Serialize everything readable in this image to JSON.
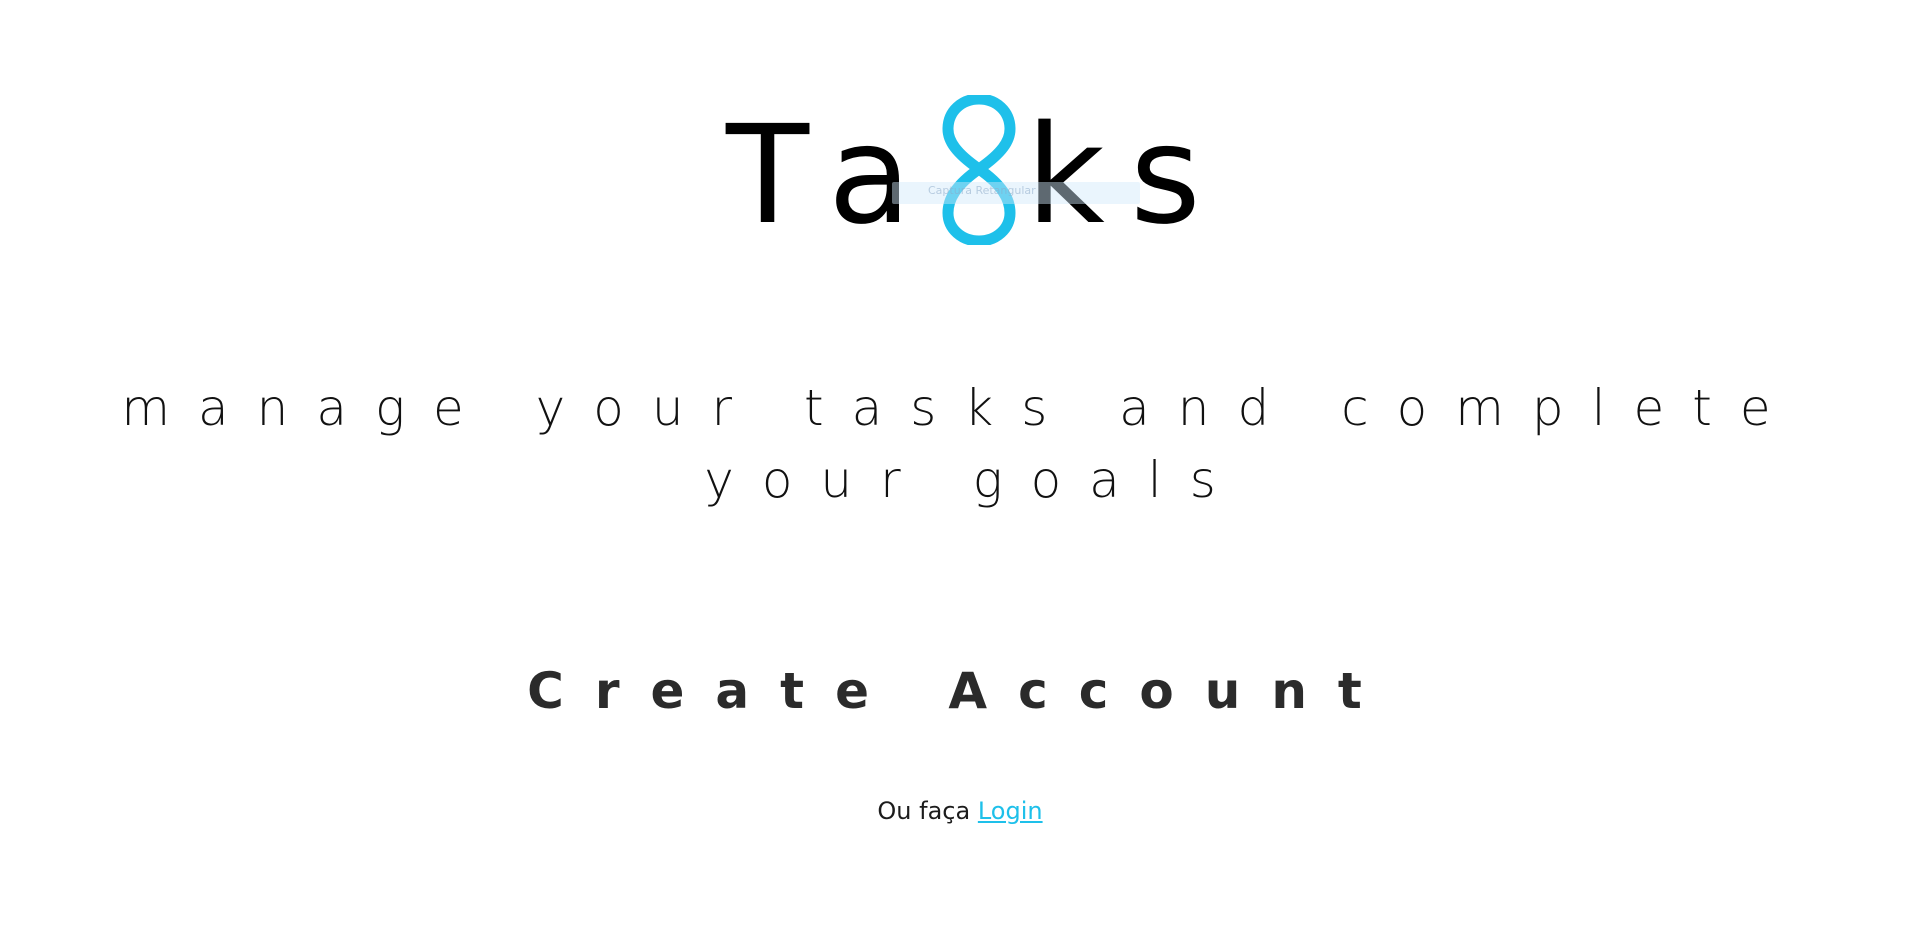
{
  "logo": {
    "letters": [
      "T",
      "a",
      "k",
      "s"
    ],
    "icon": "infinity-s-icon",
    "accent_color": "#1ec0ea",
    "overlay_text": "Captura Retangular"
  },
  "tagline": {
    "line1": "manage your tasks and complete",
    "line2": "your goals"
  },
  "create_account": {
    "label": "Create Account"
  },
  "login_prompt": {
    "prefix": "Ou faça",
    "link_label": "Login",
    "link_color": "#1ec0ea"
  }
}
